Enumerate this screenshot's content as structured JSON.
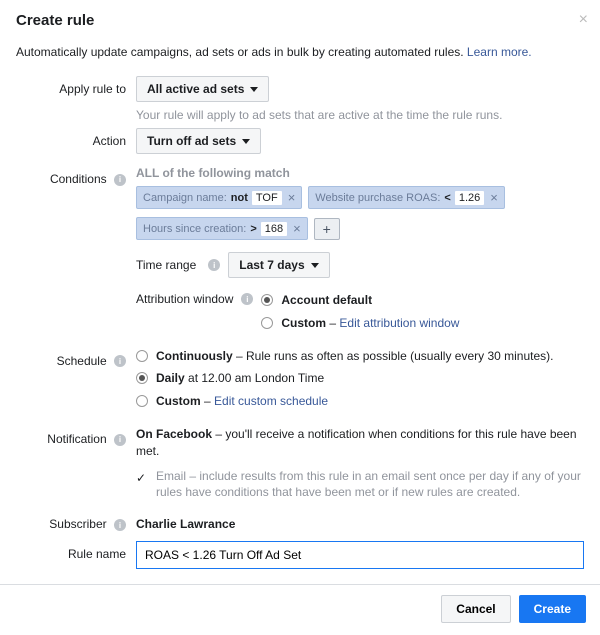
{
  "header": {
    "title": "Create rule"
  },
  "description": {
    "text": "Automatically update campaigns, ad sets or ads in bulk by creating automated rules. ",
    "link": "Learn more."
  },
  "apply": {
    "label": "Apply rule to",
    "value": "All active ad sets",
    "helper": "Your rule will apply to ad sets that are active at the time the rule runs."
  },
  "action": {
    "label": "Action",
    "value": "Turn off ad sets"
  },
  "conditions": {
    "label": "Conditions",
    "head": "ALL of the following match",
    "chips": [
      {
        "key": "Campaign name:",
        "op": "not",
        "val": "TOF"
      },
      {
        "key": "Website purchase ROAS:",
        "op": "<",
        "val": "1.26"
      },
      {
        "key": "Hours since creation:",
        "op": ">",
        "val": "168"
      }
    ],
    "time_range": {
      "label": "Time range",
      "value": "Last 7 days"
    },
    "attr_window": {
      "label": "Attribution window",
      "default": "Account default",
      "custom": "Custom",
      "custom_link": "Edit attribution window"
    }
  },
  "schedule": {
    "label": "Schedule",
    "cont": "Continuously",
    "cont_desc": " – Rule runs as often as possible (usually every 30 minutes).",
    "daily": "Daily",
    "daily_desc": " at 12.00 am London Time",
    "custom": "Custom",
    "custom_link": "Edit custom schedule"
  },
  "notification": {
    "label": "Notification",
    "fb_bold": "On Facebook",
    "fb_desc": " – you'll receive a notification when conditions for this rule have been met.",
    "email_label": "Email",
    "email_desc": " – include results from this rule in an email sent once per day if any of your rules have conditions that have been met or if new rules are created."
  },
  "subscriber": {
    "label": "Subscriber",
    "value": "Charlie Lawrance"
  },
  "rulename": {
    "label": "Rule name",
    "value": "ROAS < 1.26 Turn Off Ad Set"
  },
  "footer": {
    "cancel": "Cancel",
    "create": "Create"
  }
}
